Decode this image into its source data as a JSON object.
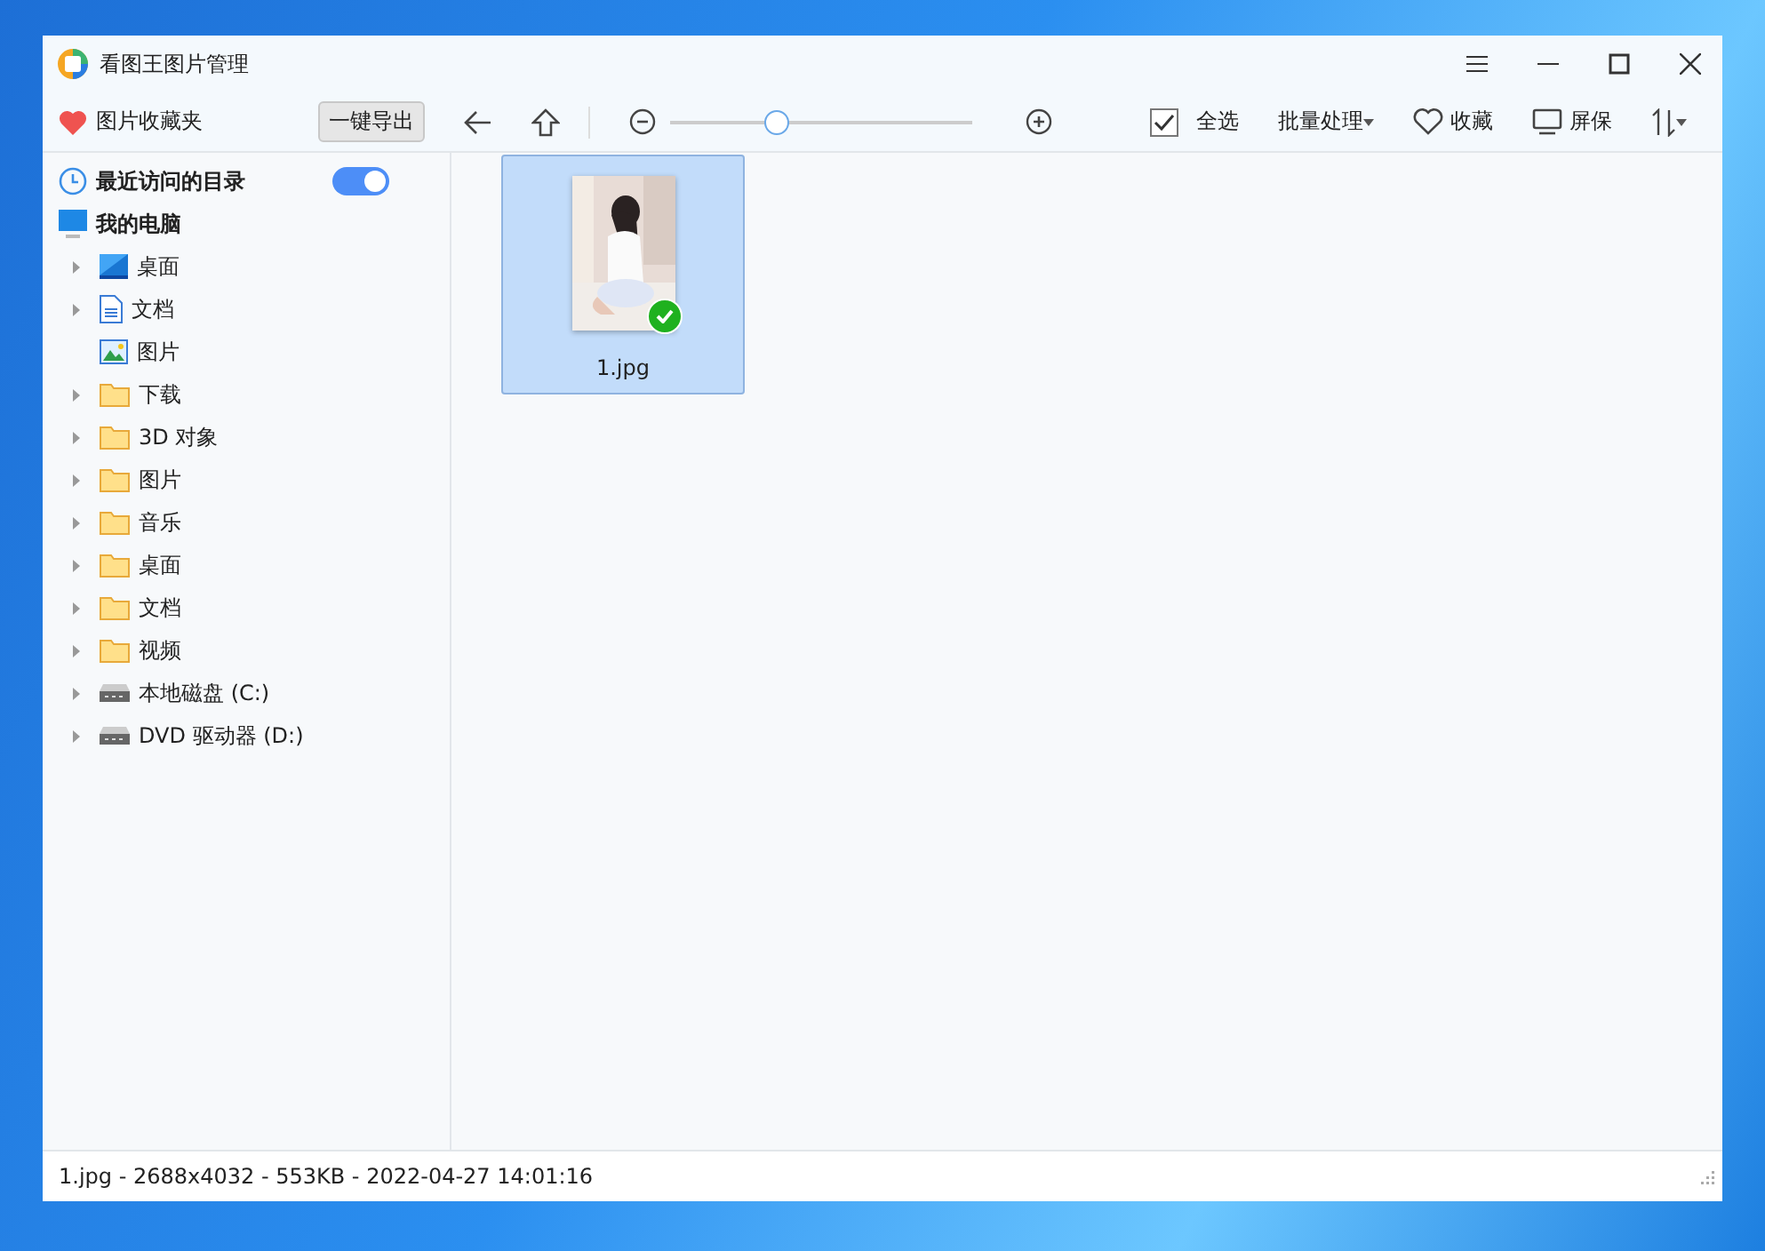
{
  "window": {
    "title": "看图王图片管理"
  },
  "toolbar": {
    "favorites": "图片收藏夹",
    "export_button": "一键导出",
    "zoom": {
      "level": 0.35
    },
    "select_all": {
      "label": "全选",
      "checked": true
    },
    "batch": "批量处理",
    "collect": "收藏",
    "screensaver": "屏保"
  },
  "sidebar": {
    "recent": {
      "label": "最近访问的目录",
      "on": true
    },
    "computer": {
      "label": "我的电脑",
      "children": [
        {
          "label": "桌面",
          "kind": "desktop",
          "expandable": true
        },
        {
          "label": "文档",
          "kind": "document",
          "expandable": true
        },
        {
          "label": "图片",
          "kind": "picture",
          "expandable": false
        },
        {
          "label": "下载",
          "kind": "folder",
          "expandable": true
        },
        {
          "label": "3D 对象",
          "kind": "folder",
          "expandable": true
        },
        {
          "label": "图片",
          "kind": "folder",
          "expandable": true
        },
        {
          "label": "音乐",
          "kind": "folder",
          "expandable": true
        },
        {
          "label": "桌面",
          "kind": "folder",
          "expandable": true
        },
        {
          "label": "文档",
          "kind": "folder",
          "expandable": true
        },
        {
          "label": "视频",
          "kind": "folder",
          "expandable": true
        },
        {
          "label": "本地磁盘 (C:)",
          "kind": "drive",
          "expandable": true
        },
        {
          "label": "DVD 驱动器 (D:)",
          "kind": "drive",
          "expandable": true
        }
      ]
    }
  },
  "files": [
    {
      "name": "1.jpg",
      "selected": true,
      "kind": "picture"
    }
  ],
  "status_bar": "1.jpg - 2688x4032 - 553KB - 2022-04-27 14:01:16"
}
